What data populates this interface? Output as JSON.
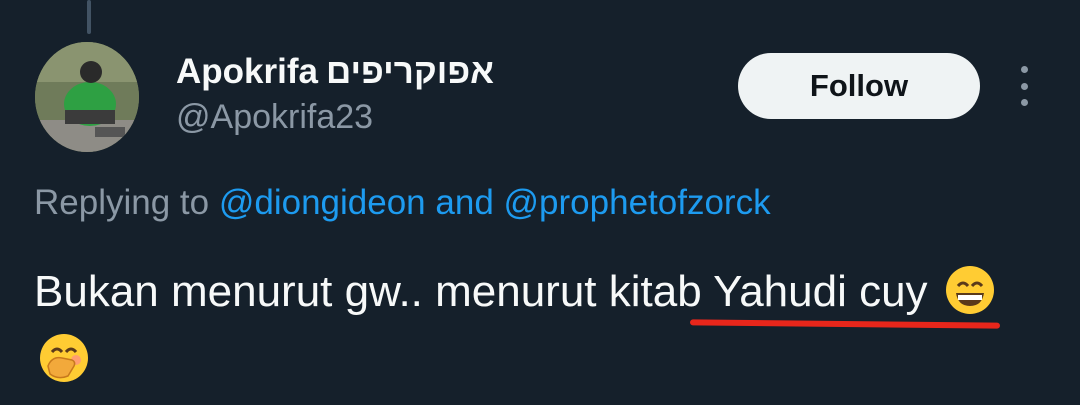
{
  "author": {
    "display_name": "Apokrifa",
    "display_name_hebrew": "אפוקריפים",
    "handle": "@Apokrifa23"
  },
  "actions": {
    "follow_label": "Follow"
  },
  "reply": {
    "prefix": "Replying to",
    "mention_1": "@diongideon",
    "conjunction": "and",
    "mention_2": "@prophetofzorck"
  },
  "tweet": {
    "text": "Bukan menurut gw.. menurut kitab Yahudi cuy",
    "emojis": [
      "grinning-face-with-smiling-eyes",
      "face-with-hand-over-mouth"
    ]
  },
  "colors": {
    "background": "#15202b",
    "link": "#1d9bf0",
    "muted": "#8b98a5",
    "annotation_underline": "#e8261b"
  }
}
